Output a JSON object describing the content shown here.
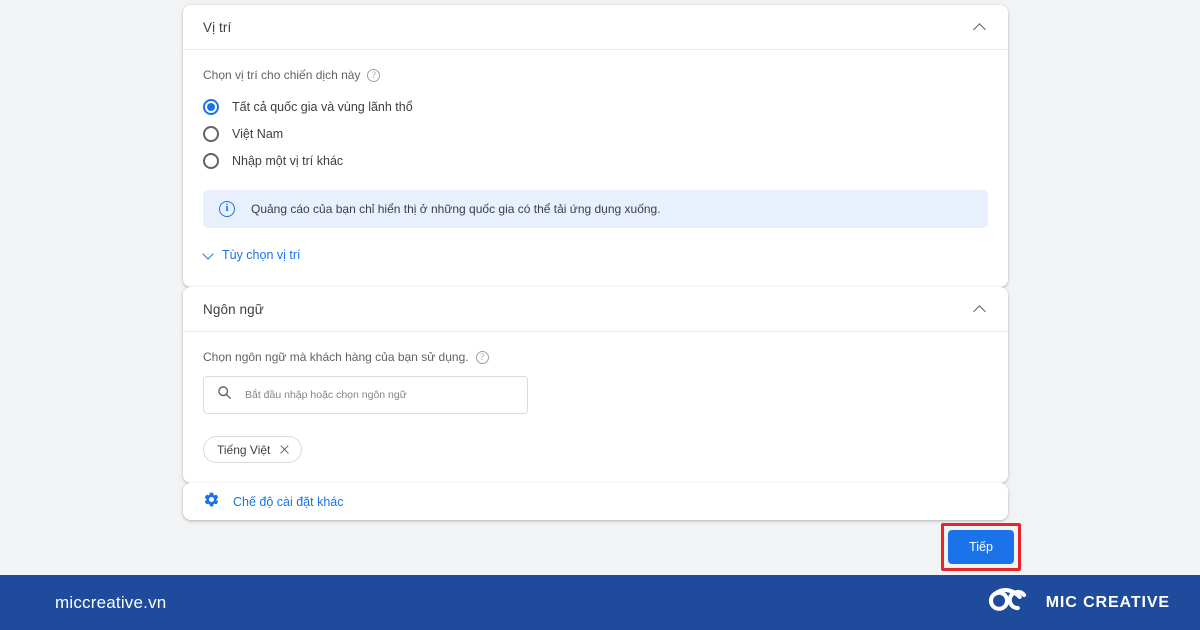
{
  "theme": {
    "page_bg": "#f1f3f4",
    "card_bg": "#ffffff",
    "accent_blue": "#1a73e8",
    "banner_bg": "#e8f0fe",
    "highlight_red": "#e8252a",
    "footer_blue": "#1e4b9c",
    "text_primary": "#3c4043",
    "text_secondary": "#5f6368"
  },
  "location_card": {
    "title": "Vị trí",
    "collapse_icon": "chevron-up-icon",
    "prompt": "Chọn vị trí cho chiến dịch này",
    "help_icon": "help-icon",
    "options": [
      {
        "label": "Tất cả quốc gia và vùng lãnh thổ",
        "selected": true
      },
      {
        "label": "Việt Nam",
        "selected": false
      },
      {
        "label": "Nhập một vị trí khác",
        "selected": false
      }
    ],
    "banner": {
      "icon": "info-icon",
      "text": "Quảng cáo của bạn chỉ hiển thị ở những quốc gia có thể tải ứng dụng xuống."
    },
    "expand_link": {
      "icon": "chevron-down-icon",
      "label": "Tùy chọn vị trí"
    }
  },
  "language_card": {
    "title": "Ngôn ngữ",
    "collapse_icon": "chevron-up-icon",
    "prompt": "Chọn ngôn ngữ mà khách hàng của bạn sử dụng.",
    "help_icon": "help-icon",
    "search": {
      "icon": "search-icon",
      "placeholder": "Bắt đầu nhập hoặc chọn ngôn ngữ",
      "value": ""
    },
    "chips": [
      {
        "label": "Tiếng Việt",
        "remove_icon": "close-icon"
      }
    ]
  },
  "settings_card": {
    "icon": "gear-icon",
    "label": "Chế độ cài đặt khác"
  },
  "actions": {
    "next_label": "Tiếp",
    "highlighted": true
  },
  "footer": {
    "url": "miccreative.vn",
    "brand_icon": "infinity-loop-logo",
    "brand_name": "MIC CREATIVE"
  }
}
